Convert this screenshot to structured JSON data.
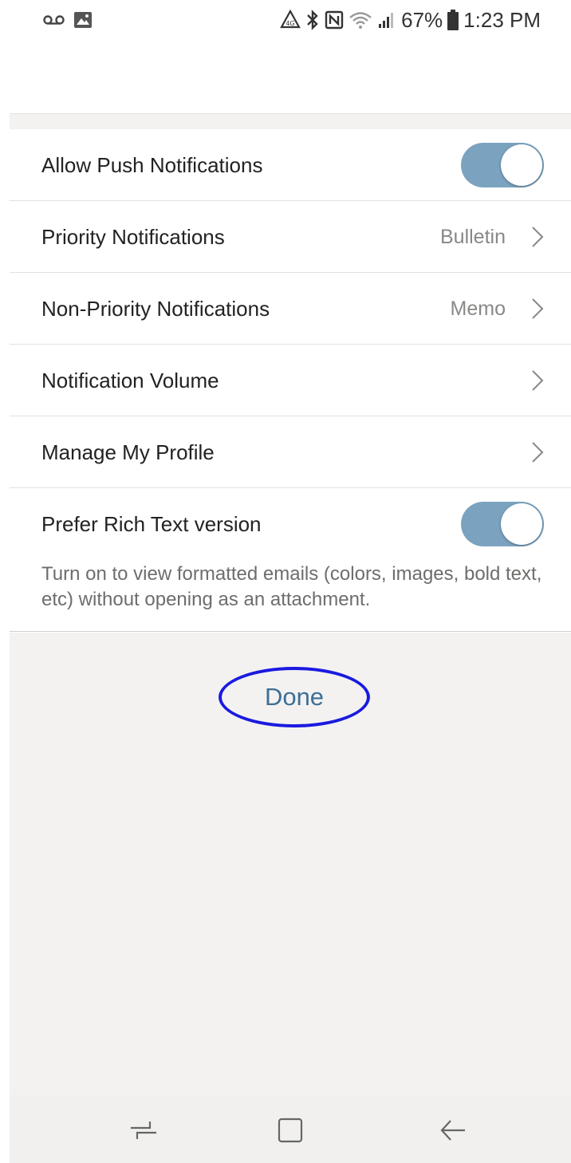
{
  "status_bar": {
    "left_icons": [
      "voicemail-icon",
      "image-icon"
    ],
    "right_icons": [
      "data-saver-icon",
      "bluetooth-icon",
      "nfc-icon",
      "wifi-icon",
      "signal-icon",
      "battery-icon"
    ],
    "battery": "67%",
    "time": "1:23 PM"
  },
  "settings": {
    "push": {
      "label": "Allow Push Notifications",
      "enabled": true
    },
    "priority": {
      "label": "Priority Notifications",
      "value": "Bulletin"
    },
    "non_priority": {
      "label": "Non-Priority Notifications",
      "value": "Memo"
    },
    "volume": {
      "label": "Notification Volume"
    },
    "profile": {
      "label": "Manage My Profile"
    },
    "rich_text": {
      "label": "Prefer Rich Text version",
      "enabled": true,
      "description": "Turn on to view formatted emails (colors, images, bold text, etc) without opening as an attachment."
    }
  },
  "done_button": {
    "label": "Done"
  },
  "nav_bar": {
    "icons": [
      "recent-apps-icon",
      "home-icon",
      "back-icon"
    ]
  },
  "colors": {
    "toggle_on": "#7ba3c0",
    "done_text": "#3e6f95",
    "highlight_circle": "#1a1ae0",
    "background_gray": "#f3f2f1"
  }
}
